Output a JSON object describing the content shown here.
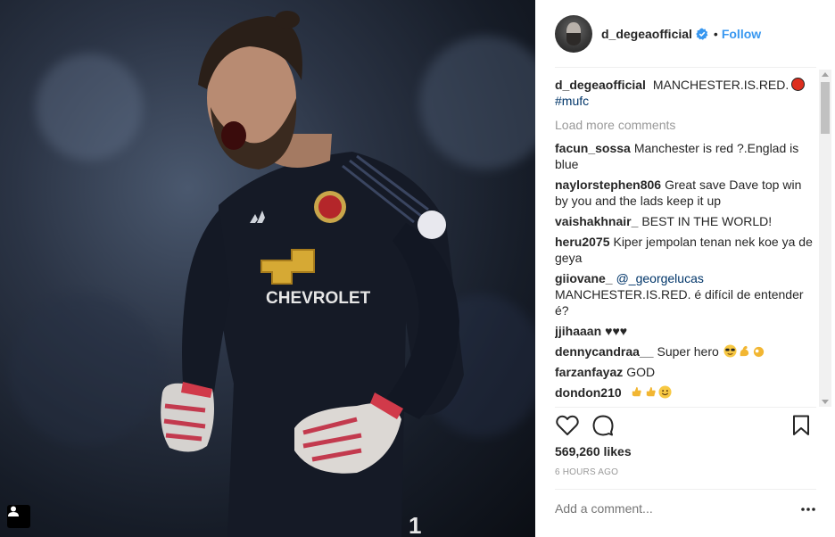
{
  "header": {
    "username": "d_degeaofficial",
    "separator": "•",
    "follow_label": "Follow"
  },
  "caption": {
    "username": "d_degeaofficial",
    "text": "MANCHESTER.IS.RED.",
    "hashtag": "#mufc"
  },
  "load_more_label": "Load more comments",
  "comments": [
    {
      "username": "facun_sossa",
      "text": "Manchester is red ?.Englad is blue"
    },
    {
      "username": "naylorstephen806",
      "text": "Great save Dave top win by you and the lads keep it up"
    },
    {
      "username": "vaishakhnair_",
      "text": "BEST IN THE WORLD!"
    },
    {
      "username": "heru2075",
      "text": "Kiper jempolan tenan nek koe ya de geya"
    },
    {
      "username": "giiovane_",
      "mention": "@_georgelucas",
      "text": "MANCHESTER.IS.RED. é difícil de entender é?"
    },
    {
      "username": "jjihaaan",
      "text": "♥♥♥"
    },
    {
      "username": "dennycandraa__",
      "text": "Super hero"
    },
    {
      "username": "farzanfayaz",
      "text": "GOD"
    },
    {
      "username": "dondon210",
      "text": ""
    }
  ],
  "likes": "569,260 likes",
  "timestamp": "6 HOURS AGO",
  "add_comment_placeholder": "Add a comment...",
  "photo": {
    "sponsor_text": "CHEVROLET"
  },
  "colors": {
    "link_blue": "#3897f0",
    "mention_blue": "#003569",
    "muted": "#999999",
    "text": "#262626"
  },
  "icons": [
    "verified-badge-icon",
    "heart-icon",
    "comment-bubble-icon",
    "bookmark-icon",
    "more-options-icon",
    "user-tag-icon"
  ]
}
